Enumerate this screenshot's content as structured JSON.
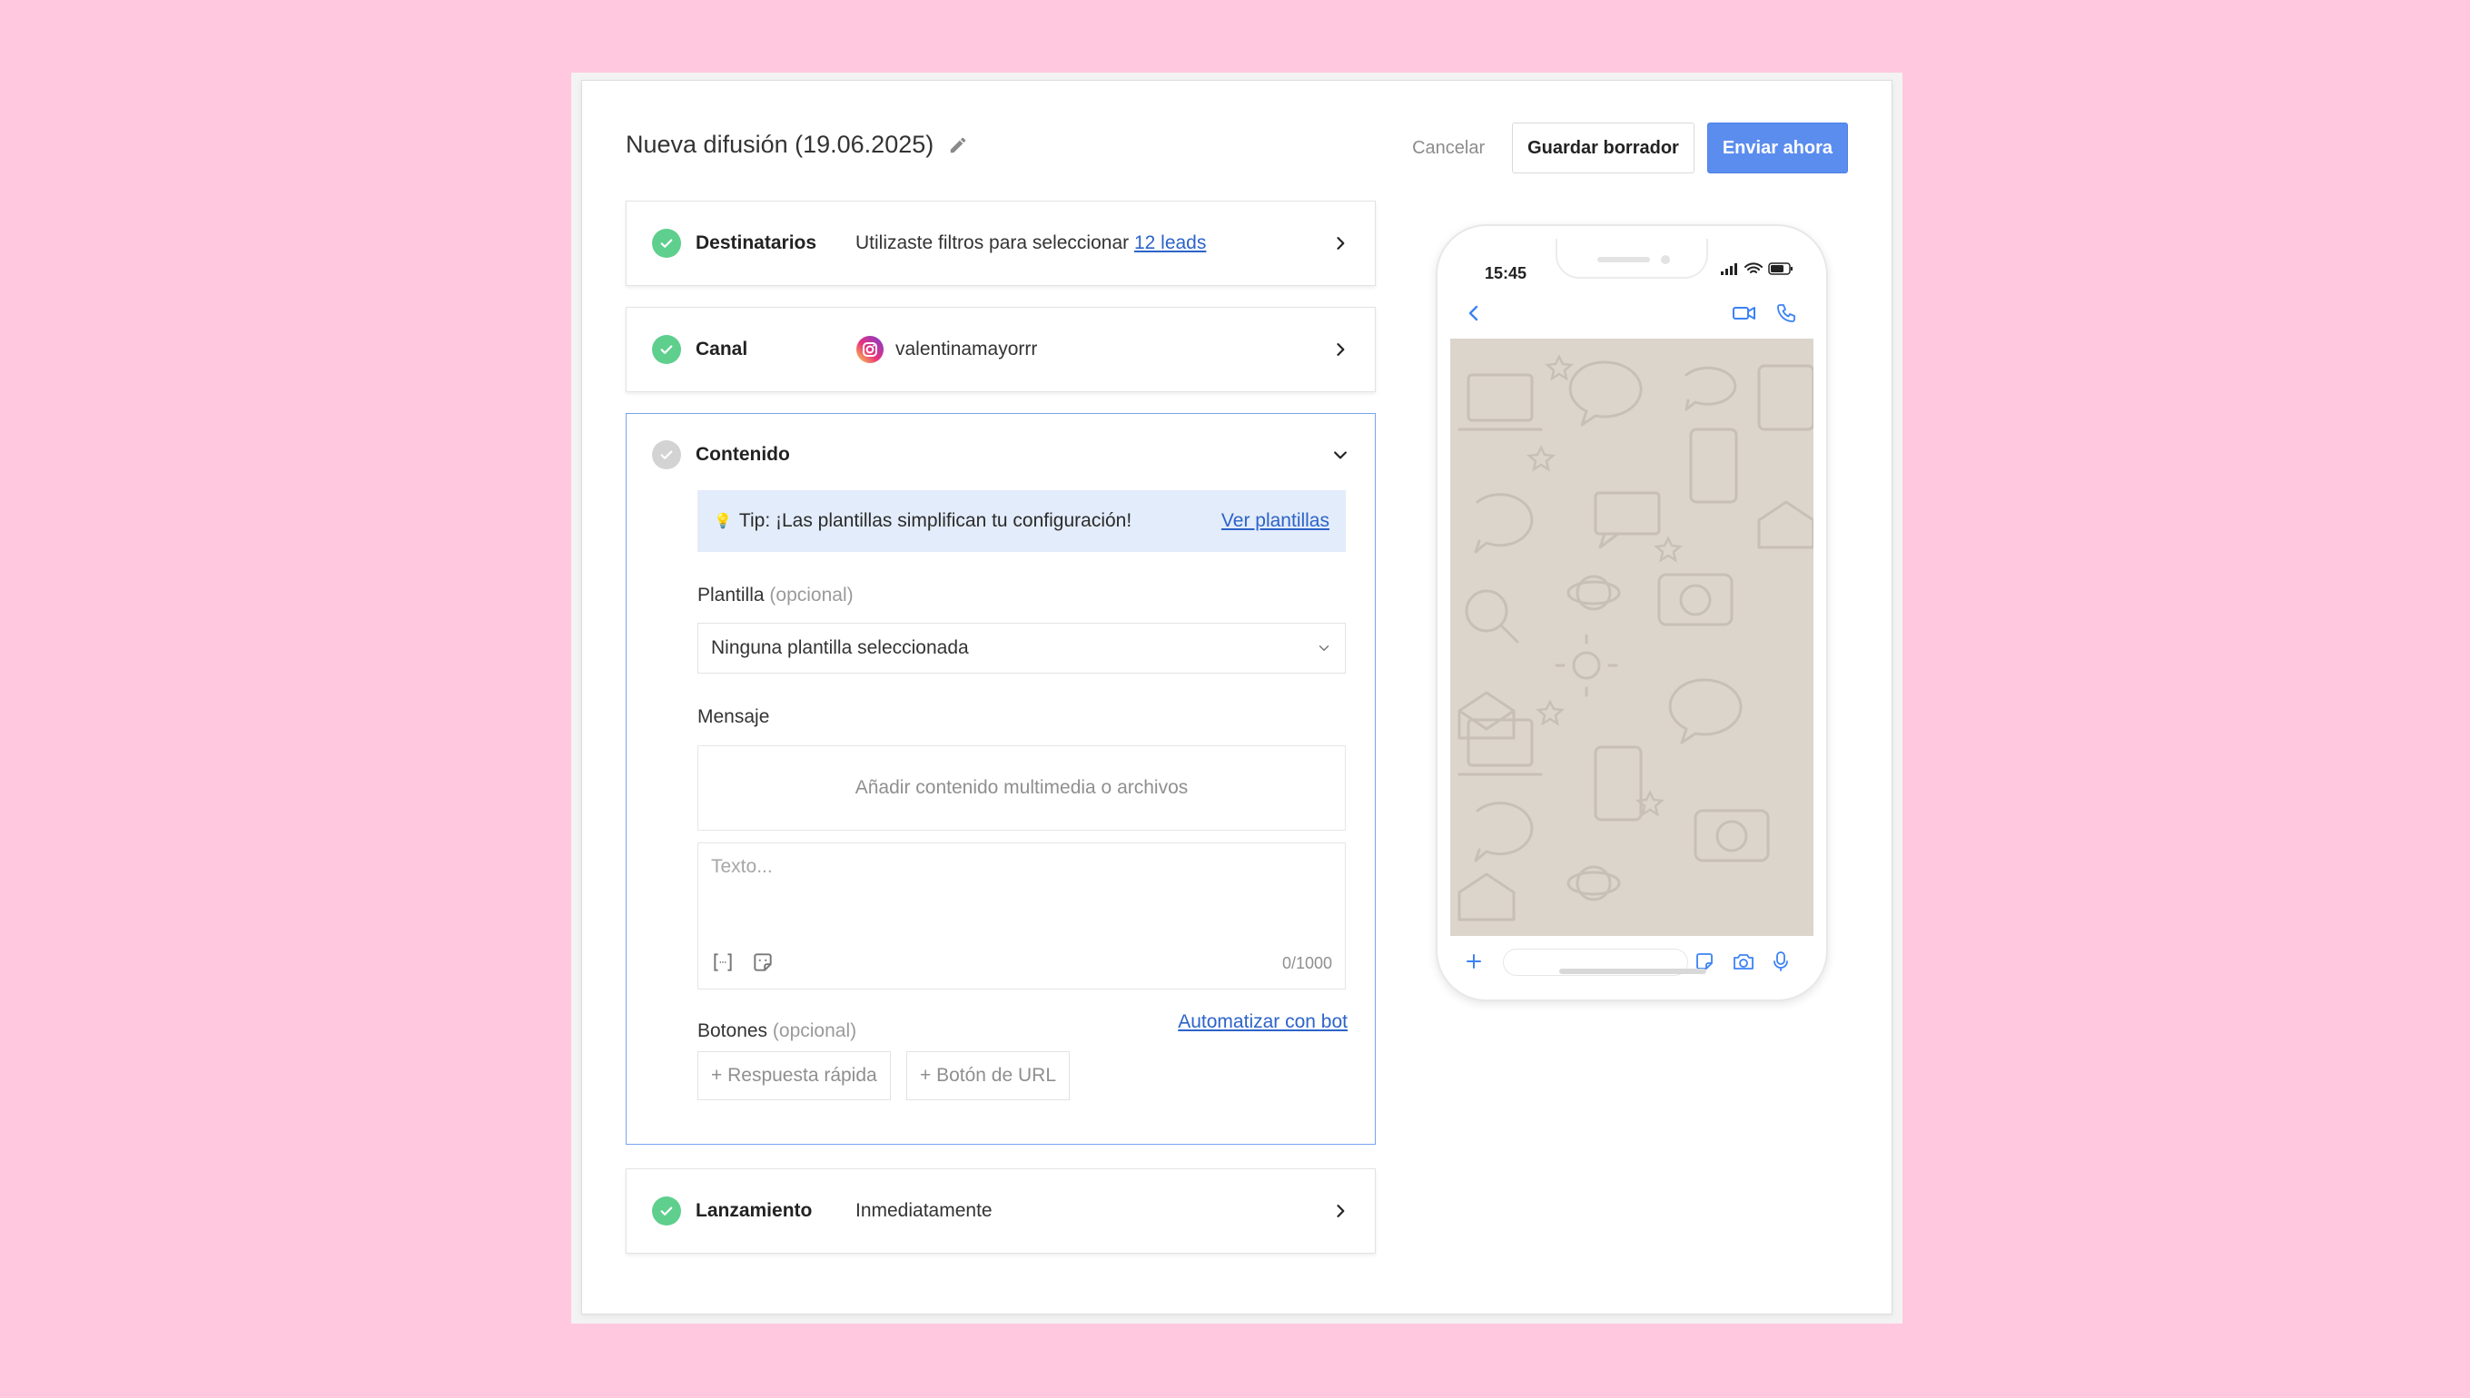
{
  "header": {
    "title": "Nueva difusión (19.06.2025)",
    "cancel_label": "Cancelar",
    "draft_label": "Guardar borrador",
    "send_label": "Enviar ahora"
  },
  "steps": {
    "recipients": {
      "label": "Destinatarios",
      "text": "Utilizaste filtros para seleccionar",
      "link": "12 leads",
      "status": "complete"
    },
    "channel": {
      "label": "Canal",
      "account": "valentinamayorrr",
      "icon": "instagram-icon",
      "status": "complete"
    },
    "content": {
      "label": "Contenido",
      "status": "incomplete",
      "tip_icon": "💡",
      "tip_text": "Tip: ¡Las plantillas simplifican tu configuración!",
      "tip_link": "Ver plantillas",
      "template_label": "Plantilla",
      "template_optional": "(opcional)",
      "template_value": "Ninguna plantilla seleccionada",
      "message_label": "Mensaje",
      "media_placeholder": "Añadir contenido multimedia o archivos",
      "text_placeholder": "Texto...",
      "char_count": "0/1000",
      "buttons_label": "Botones",
      "buttons_optional": "(opcional)",
      "bot_link": "Automatizar con bot",
      "quick_reply_label": "+ Respuesta rápida",
      "url_button_label": "+ Botón de URL"
    },
    "launch": {
      "label": "Lanzamiento",
      "value": "Inmediatamente",
      "status": "complete"
    }
  },
  "preview": {
    "time": "15:45"
  },
  "colors": {
    "page_bg": "#ffc8df",
    "primary": "#5b8def",
    "success": "#5fcf8e",
    "link": "#2c63c9",
    "tip_bg": "#e3ecfa",
    "chat_bg": "#dcd5cc"
  }
}
